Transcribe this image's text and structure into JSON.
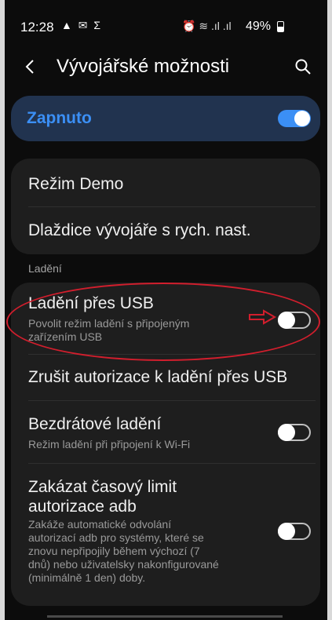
{
  "status_bar": {
    "time": "12:28",
    "left_icons": "▲ ✉ Σ",
    "right_icons": "⏰ ≋ .ıl .ıl",
    "battery": "49%",
    "battery_level_percent": 49
  },
  "app_bar": {
    "title": "Vývojářské možnosti"
  },
  "master_switch": {
    "label": "Zapnuto",
    "on": true
  },
  "group1": {
    "items": [
      {
        "title": "Režim Demo"
      },
      {
        "title": "Dlaždice vývojáře s rych. nast."
      }
    ]
  },
  "section": {
    "label": "Ladění"
  },
  "group2": {
    "items": [
      {
        "title": "Ladění přes USB",
        "subtitle_line1": "Povolit režim ladění s připojeným",
        "subtitle_line2": "zařízením USB",
        "on": false
      },
      {
        "title": "Zrušit autorizace k ladění přes USB"
      },
      {
        "title": "Bezdrátové ladění",
        "subtitle_line1": "Režim ladění při připojení k Wi-Fi",
        "on": false
      },
      {
        "title_line1": "Zakázat časový limit",
        "title_line2": "autorizace adb",
        "sub1": "Zakáže automatické odvolání",
        "sub2": "autorizací adb pro systémy, které se",
        "sub3": "znovu nepřipojily během výchozí (7",
        "sub4": "dnů) nebo uživatelsky nakonfigurované",
        "sub5": "(minimálně 1 den) doby.",
        "on": false
      }
    ]
  },
  "colors": {
    "accent": "#3b8ff5",
    "highlight": "#d21e2d",
    "card": "#1e1e1e"
  }
}
